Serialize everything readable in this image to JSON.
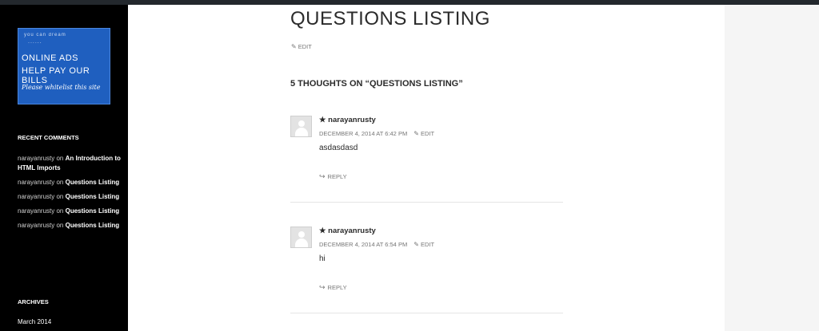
{
  "sidebar": {
    "ad": {
      "small_text": "you can dream",
      "dots": "......",
      "line1": "ONLINE ADS",
      "line2": "HELP PAY OUR BILLS",
      "line3": "Please whitelist this site"
    },
    "recent_comments_title": "RECENT COMMENTS",
    "recent_comments": [
      {
        "author": "narayanrusty",
        "on": "on",
        "post": "An Introduction to HTML Imports"
      },
      {
        "author": "narayanrusty",
        "on": "on",
        "post": "Questions Listing"
      },
      {
        "author": "narayanrusty",
        "on": "on",
        "post": "Questions Listing"
      },
      {
        "author": "narayanrusty",
        "on": "on",
        "post": "Questions Listing"
      },
      {
        "author": "narayanrusty",
        "on": "on",
        "post": "Questions Listing"
      }
    ],
    "archives_title": "ARCHIVES",
    "archives": [
      "March 2014"
    ]
  },
  "post": {
    "title": "QUESTIONS LISTING",
    "edit_label": "EDIT"
  },
  "comments": {
    "title": "5 THOUGHTS ON “QUESTIONS LISTING”",
    "items": [
      {
        "author": "★ narayanrusty",
        "date": "DECEMBER 4, 2014 AT 6:42 PM",
        "edit": "EDIT",
        "text": "asdasdasd",
        "reply": "REPLY"
      },
      {
        "author": "★ narayanrusty",
        "date": "DECEMBER 4, 2014 AT 6:54 PM",
        "edit": "EDIT",
        "text": "hi",
        "reply": "REPLY"
      }
    ]
  },
  "icons": {
    "edit": "pencil-icon",
    "reply": "reply-arrow-icon",
    "avatar": "default-avatar-icon"
  },
  "colors": {
    "sidebar_bg": "#000000",
    "ad_bg": "#1f5fbf",
    "meta_text": "#767676"
  }
}
